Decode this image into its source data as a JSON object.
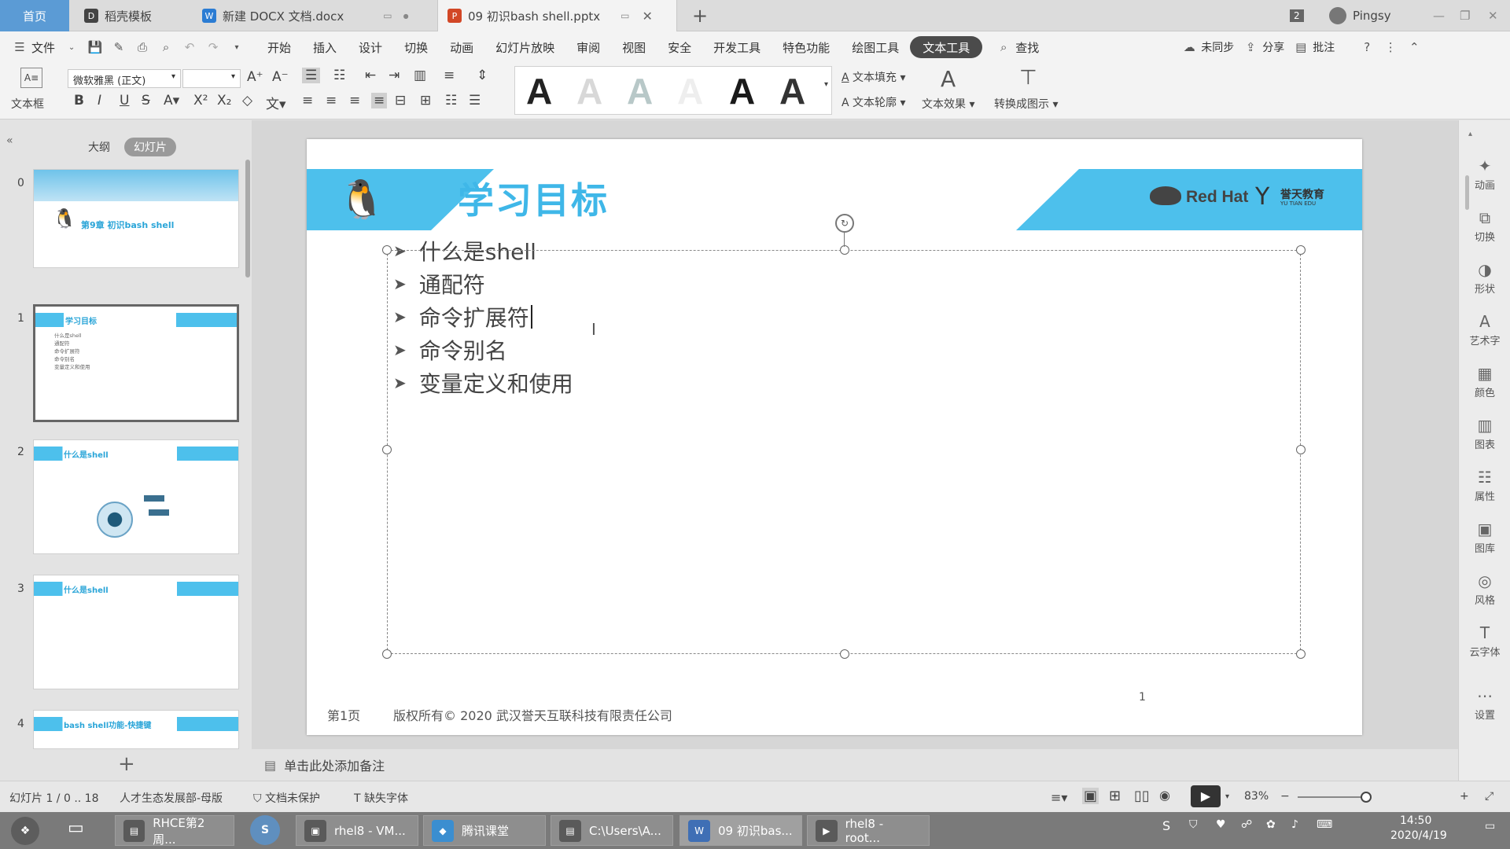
{
  "tabs": {
    "home": "首页",
    "daoke": "稻壳模板",
    "docx": "新建 DOCX 文档.docx",
    "pptx": "09 初识bash shell.pptx",
    "count": "2",
    "user": "Pingsy"
  },
  "menu": {
    "file": "文件",
    "items": [
      "开始",
      "插入",
      "设计",
      "切换",
      "动画",
      "幻灯片放映",
      "审阅",
      "视图",
      "安全",
      "开发工具",
      "特色功能",
      "绘图工具",
      "文本工具"
    ],
    "search": "查找",
    "sync": "未同步",
    "share": "分享",
    "comment": "批注"
  },
  "ribbon": {
    "textbox": "文本框",
    "font": "微软雅黑 (正文)",
    "size": "",
    "text_fill": "文本填充",
    "text_outline": "文本轮廓",
    "text_effect": "文本效果",
    "convert_smartart": "转换成图示"
  },
  "leftpanel": {
    "tab_outline": "大纲",
    "tab_slides": "幻灯片",
    "slides": [
      {
        "num": "0",
        "title": "第9章 初识bash shell"
      },
      {
        "num": "1",
        "title": "学习目标",
        "lines": [
          "什么是shell",
          "通配符",
          "命令扩展符",
          "命令别名",
          "变量定义和使用"
        ]
      },
      {
        "num": "2",
        "title": "什么是shell"
      },
      {
        "num": "3",
        "title": "什么是shell"
      },
      {
        "num": "4",
        "title": "bash shell功能-快捷键"
      }
    ]
  },
  "slide": {
    "title": "学习目标",
    "logo_text": "Red Hat",
    "logo_sub": "誉天教育",
    "logo_sub2": "YU TIAN EDU",
    "bullets": [
      "什么是shell",
      "通配符",
      "命令扩展符",
      "命令别名",
      "变量定义和使用"
    ],
    "footer_page": "第1页",
    "footer_copyright": "版权所有© 2020 武汉誉天互联科技有限责任公司",
    "page_number": "1"
  },
  "rightbar": [
    "动画",
    "切换",
    "形状",
    "艺术字",
    "颜色",
    "图表",
    "属性",
    "图库",
    "风格",
    "云字体",
    "设置"
  ],
  "notebar": "单击此处添加备注",
  "statusbar": {
    "slide_info": "幻灯片 1 / 0 .. 18",
    "theme": "人才生态发展部-母版",
    "protect": "文档未保护",
    "missing_font": "缺失字体",
    "zoom": "83%"
  },
  "taskbar": {
    "items": [
      "RHCE第2周...",
      "rhel8 - VM...",
      "腾讯课堂",
      "C:\\Users\\A...",
      "09 初识bas...",
      "rhel8 - root..."
    ],
    "time": "14:50",
    "date": "2020/4/19"
  }
}
